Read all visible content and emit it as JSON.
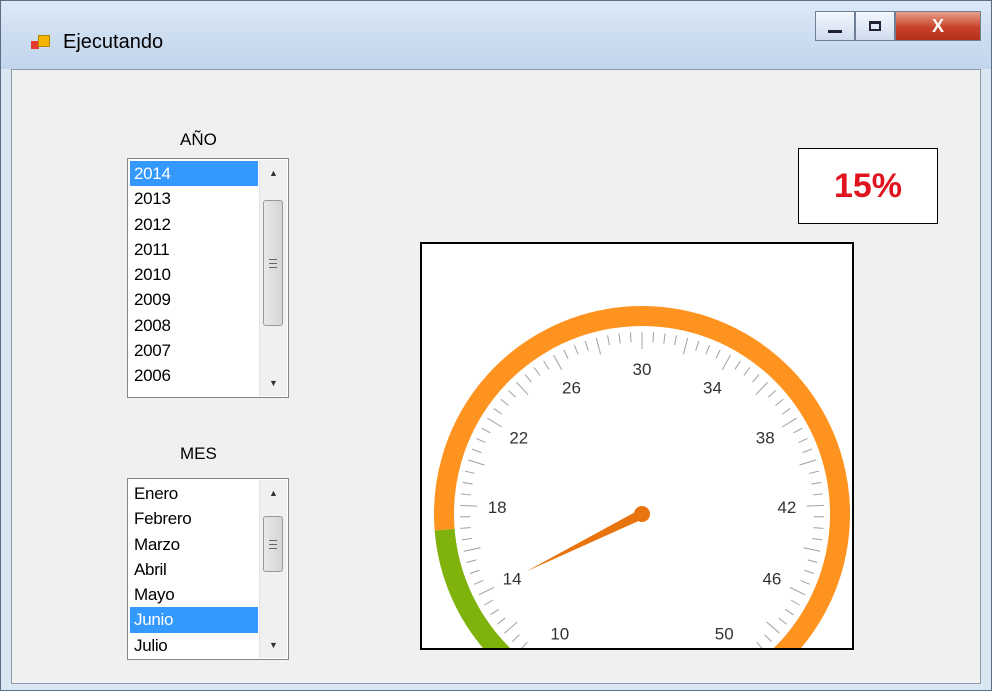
{
  "window": {
    "title": "Ejecutando",
    "minimize_icon": "minimize-icon",
    "maximize_icon": "maximize-icon",
    "close_icon": "close-icon",
    "close_label": "X"
  },
  "year": {
    "label": "AÑO",
    "items": [
      "2014",
      "2013",
      "2012",
      "2011",
      "2010",
      "2009",
      "2008",
      "2007",
      "2006"
    ],
    "selected": "2014"
  },
  "month": {
    "label": "MES",
    "items": [
      "Enero",
      "Febrero",
      "Marzo",
      "Abril",
      "Mayo",
      "Junio",
      "Julio"
    ],
    "selected": "Junio"
  },
  "percentage": {
    "text": "15%",
    "color": "#e0141e"
  },
  "gauge": {
    "min": 8,
    "max": 52,
    "tick_labels": [
      10,
      14,
      18,
      22,
      26,
      30,
      34,
      38,
      42,
      46,
      50
    ],
    "value": 14,
    "ranges": [
      {
        "from": 8,
        "to": 17,
        "color": "#7fb20a"
      },
      {
        "from": 17,
        "to": 52,
        "color": "#ff9320"
      }
    ],
    "needle_color": "#e8740e",
    "tick_color": "#a0a0a0",
    "label_color": "#333333"
  }
}
